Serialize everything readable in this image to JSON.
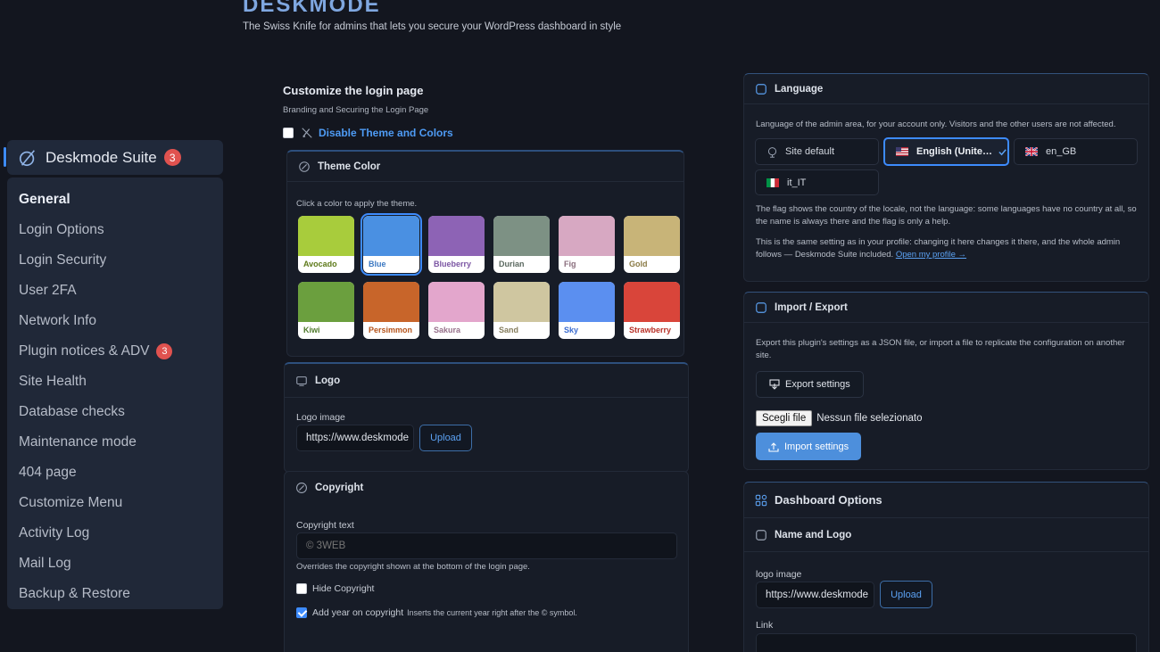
{
  "brand": {
    "name": "DESKMODE",
    "tagline": "The Swiss Knife for admins that lets you secure your WordPress dashboard in style"
  },
  "colors": {
    "accent": "#3d8bfd",
    "badge": "#e0524f",
    "background": "#13161f",
    "link": "#5ba1f2"
  },
  "sidebar": {
    "suite_label": "Deskmode Suite",
    "suite_badge": "3",
    "items": [
      {
        "label": "General",
        "active": true
      },
      {
        "label": "Login Options"
      },
      {
        "label": "Login Security"
      },
      {
        "label": "User 2FA"
      },
      {
        "label": "Network Info"
      },
      {
        "label": "Plugin notices & ADV",
        "badge": "3"
      },
      {
        "label": "Site Health"
      },
      {
        "label": "Database checks"
      },
      {
        "label": "Maintenance mode"
      },
      {
        "label": "404 page"
      },
      {
        "label": "Customize Menu"
      },
      {
        "label": "Activity Log"
      },
      {
        "label": "Mail Log"
      },
      {
        "label": "Backup & Restore"
      }
    ]
  },
  "login_page": {
    "title": "Customize the login page",
    "subtitle": "Branding and Securing the Login Page",
    "disable_label": "Disable Theme and Colors",
    "disable_checked": false,
    "theme": {
      "title": "Theme Color",
      "hint": "Click a color to apply the theme.",
      "selected": "Blue",
      "swatches": [
        {
          "name": "Avocado",
          "color": "#a8cc3c",
          "text": "#5e7a1a"
        },
        {
          "name": "Blue",
          "color": "#4a90e2",
          "text": "#3b78c2"
        },
        {
          "name": "Blueberry",
          "color": "#8d63b5",
          "text": "#7b55a3"
        },
        {
          "name": "Durian",
          "color": "#7d9184",
          "text": "#5c6a61"
        },
        {
          "name": "Fig",
          "color": "#d7a8c2",
          "text": "#8a6e7d"
        },
        {
          "name": "Gold",
          "color": "#c8b478",
          "text": "#8a7a45"
        },
        {
          "name": "Kiwi",
          "color": "#6b9f3e",
          "text": "#4f7a2c"
        },
        {
          "name": "Persimmon",
          "color": "#c8652a",
          "text": "#b5531a"
        },
        {
          "name": "Sakura",
          "color": "#e3a6cc",
          "text": "#96708a"
        },
        {
          "name": "Sand",
          "color": "#cfc6a0",
          "text": "#857d5d"
        },
        {
          "name": "Sky",
          "color": "#5b8ff0",
          "text": "#3b6ccf"
        },
        {
          "name": "Strawberry",
          "color": "#d9453a",
          "text": "#b83128"
        }
      ]
    },
    "logo": {
      "title": "Logo",
      "label": "Logo image",
      "value": "https://www.deskmode",
      "upload": "Upload"
    },
    "copyright": {
      "title": "Copyright",
      "label": "Copyright text",
      "placeholder": "© 3WEB",
      "help": "Overrides the copyright shown at the bottom of the login page.",
      "hide_label": "Hide Copyright",
      "hide_checked": false,
      "year_label": "Add year on copyright",
      "year_help": "Inserts the current year right after the © symbol.",
      "year_checked": true
    }
  },
  "language": {
    "title": "Language",
    "description": "Language of the admin area, for your account only. Visitors and the other users are not affected.",
    "options": [
      {
        "label": "Site default",
        "icon": "globe-icon"
      },
      {
        "label": "English (Unite…",
        "flag": "us",
        "selected": true
      },
      {
        "label": "en_GB",
        "flag": "gb"
      },
      {
        "label": "it_IT",
        "flag": "it"
      }
    ],
    "note1": "The flag shows the country of the locale, not the language: some languages have no country at all, so the name is always there and the flag is only a help.",
    "note2": "This is the same setting as in your profile: changing it here changes it there, and the whole admin follows — Deskmode Suite included.",
    "profile_link": "Open my profile →"
  },
  "import_export": {
    "title": "Import / Export",
    "description": "Export this plugin's settings as a JSON file, or import a file to replicate the configuration on another site.",
    "export_label": "Export settings",
    "choose_file": "Scegli file",
    "no_file": "Nessun file selezionato",
    "import_label": "Import settings"
  },
  "dashboard": {
    "title": "Dashboard Options",
    "name_logo_title": "Name and Logo",
    "logo_label": "logo image",
    "logo_value": "https://www.deskmode",
    "upload": "Upload",
    "link_label": "Link"
  }
}
